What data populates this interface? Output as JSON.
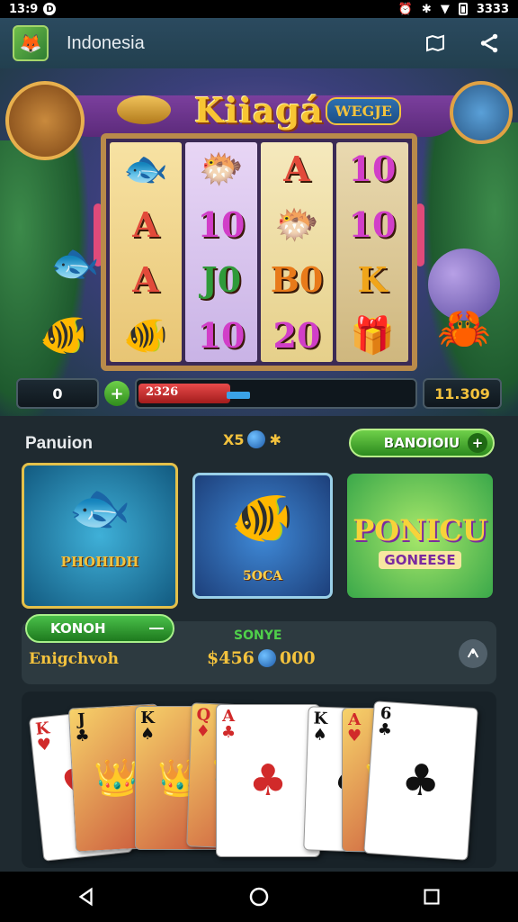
{
  "status_bar": {
    "time": "13:9",
    "notification_badge": "D",
    "battery_text": "3333"
  },
  "app_bar": {
    "title": "Indonesia",
    "icons": [
      "app-logo-icon",
      "map-icon",
      "share-icon"
    ]
  },
  "slot": {
    "title": "Kiiagá",
    "badge": "WEGJE",
    "reels": [
      [
        "🐟",
        "A",
        "A",
        "🐠"
      ],
      [
        "🐡",
        "10",
        "J0",
        "10"
      ],
      [
        "A",
        "🐡",
        "B0",
        "20"
      ],
      [
        "10",
        "10",
        "K",
        "🎁"
      ]
    ],
    "reel_colors": {
      "A": "#e24a3a",
      "10": "#d13ec8",
      "J0": "#2f9a3a",
      "B0": "#e87a1a",
      "20": "#d13ec8",
      "K": "#f0a51a"
    }
  },
  "bet_bar": {
    "left_value": "0",
    "plus_label": "+",
    "progress_label": "2326",
    "progress_fraction": 0.11,
    "right_value": "11.309"
  },
  "section": {
    "title": "Panuion",
    "chip_left": "X5",
    "chip_right": "✱",
    "button_label": "BANOIOIU",
    "button_plus": "+"
  },
  "games": [
    {
      "label": "PHOHIDH"
    },
    {
      "label": "5OCA"
    },
    {
      "title": "PONICU",
      "subtitle": "GONEESE"
    }
  ],
  "promo": {
    "pill_label": "KONOH",
    "line": "Enigchvoh",
    "subtitle": "SONYE",
    "amount_left": "$456",
    "amount_right": "000"
  },
  "playing_cards": [
    {
      "rank": "K",
      "suit": "♥",
      "color": "red"
    },
    {
      "rank": "J",
      "suit": "♣",
      "color": "black",
      "face": true
    },
    {
      "rank": "K",
      "suit": "♠",
      "color": "black",
      "face": true
    },
    {
      "rank": "Q",
      "suit": "♦",
      "color": "red",
      "face": true
    },
    {
      "rank": "A",
      "suit": "♣",
      "color": "red"
    },
    {
      "rank": "K",
      "suit": "♠",
      "color": "black"
    },
    {
      "rank": "A",
      "suit": "♥",
      "color": "red",
      "face": true
    },
    {
      "rank": "6",
      "suit": "♣",
      "color": "black"
    }
  ],
  "nav": [
    "back-icon",
    "home-icon",
    "recents-icon"
  ]
}
